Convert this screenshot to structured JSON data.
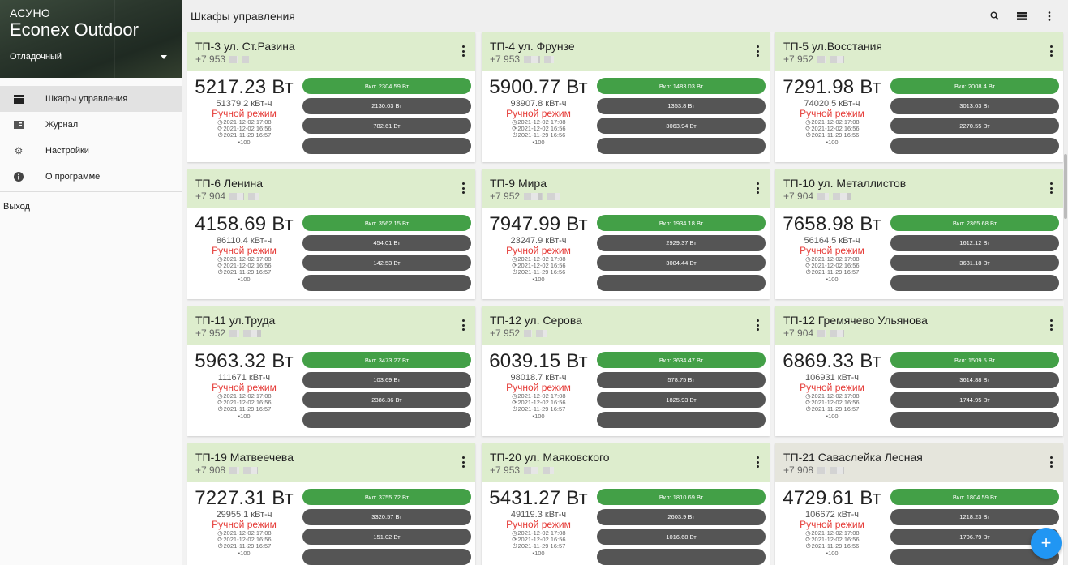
{
  "sidebar": {
    "app_small": "АСУНО",
    "app_big": "Econex Outdoor",
    "mode": "Отладочный",
    "items": [
      {
        "label": "Шкафы управления",
        "icon": "cabinet-list-icon",
        "active": true
      },
      {
        "label": "Журнал",
        "icon": "journal-icon",
        "active": false
      },
      {
        "label": "Настройки",
        "icon": "gear-icon",
        "active": false
      },
      {
        "label": "О программе",
        "icon": "info-icon",
        "active": false
      }
    ],
    "exit": "Выход"
  },
  "topbar": {
    "title": "Шкафы управления",
    "icons": [
      "search-icon",
      "list-view-icon",
      "more-vert-icon"
    ]
  },
  "cards": [
    {
      "title": "ТП-3 ул. Ст.Разина",
      "phone": "+7 953",
      "power": "5217.23 Вт",
      "energy": "51379.2 кВт-ч",
      "mode": "Ручной режим",
      "ts1": "2021-12-02 17:08",
      "ts2": "2021-12-02 16:56",
      "ts3": "2021-11-29 16:57",
      "msg": "100",
      "ch": [
        "Вкл: 2304.59 Вт",
        "2130.03 Вт",
        "782.61 Вт",
        ""
      ]
    },
    {
      "title": "ТП-4 ул. Фрунзе",
      "phone": "+7 953",
      "power": "5900.77 Вт",
      "energy": "93907.8 кВт-ч",
      "mode": "Ручной режим",
      "ts1": "2021-12-02 17:08",
      "ts2": "2021-12-02 16:56",
      "ts3": "2021-11-29 16:56",
      "msg": "100",
      "ch": [
        "Вкл: 1483.03 Вт",
        "1353.8 Вт",
        "3063.94 Вт",
        ""
      ]
    },
    {
      "title": "ТП-5 ул.Восстания",
      "phone": "+7 952",
      "power": "7291.98 Вт",
      "energy": "74020.5 кВт-ч",
      "mode": "Ручной режим",
      "ts1": "2021-12-02 17:08",
      "ts2": "2021-12-02 16:56",
      "ts3": "2021-11-29 16:56",
      "msg": "100",
      "ch": [
        "Вкл: 2008.4 Вт",
        "3013.03 Вт",
        "2270.55 Вт",
        ""
      ]
    },
    {
      "title": "ТП-6 Ленина",
      "phone": "+7 904",
      "power": "4158.69 Вт",
      "energy": "86110.4 кВт-ч",
      "mode": "Ручной режим",
      "ts1": "2021-12-02 17:08",
      "ts2": "2021-12-02 16:56",
      "ts3": "2021-11-29 16:57",
      "msg": "100",
      "ch": [
        "Вкл: 3562.15 Вт",
        "454.01 Вт",
        "142.53 Вт",
        ""
      ]
    },
    {
      "title": "ТП-9 Мира",
      "phone": "+7 952",
      "power": "7947.99 Вт",
      "energy": "23247.9 кВт-ч",
      "mode": "Ручной режим",
      "ts1": "2021-12-02 17:08",
      "ts2": "2021-12-02 16:56",
      "ts3": "2021-11-29 16:56",
      "msg": "100",
      "ch": [
        "Вкл: 1934.18 Вт",
        "2929.37 Вт",
        "3084.44 Вт",
        ""
      ]
    },
    {
      "title": "ТП-10 ул. Металлистов",
      "phone": "+7 904",
      "power": "7658.98 Вт",
      "energy": "56164.5 кВт-ч",
      "mode": "Ручной режим",
      "ts1": "2021-12-02 17:08",
      "ts2": "2021-12-02 16:56",
      "ts3": "2021-11-29 16:57",
      "msg": "100",
      "ch": [
        "Вкл: 2365.68 Вт",
        "1612.12 Вт",
        "3681.18 Вт",
        ""
      ]
    },
    {
      "title": "ТП-11 ул.Труда",
      "phone": "+7 952",
      "power": "5963.32 Вт",
      "energy": "111671 кВт-ч",
      "mode": "Ручной режим",
      "ts1": "2021-12-02 17:08",
      "ts2": "2021-12-02 16:56",
      "ts3": "2021-11-29 16:57",
      "msg": "100",
      "ch": [
        "Вкл: 3473.27 Вт",
        "103.69 Вт",
        "2386.36 Вт",
        ""
      ]
    },
    {
      "title": "ТП-12 ул. Серова",
      "phone": "+7 952",
      "power": "6039.15 Вт",
      "energy": "98018.7 кВт-ч",
      "mode": "Ручной режим",
      "ts1": "2021-12-02 17:08",
      "ts2": "2021-12-02 16:56",
      "ts3": "2021-11-29 16:57",
      "msg": "100",
      "ch": [
        "Вкл: 3634.47 Вт",
        "578.75 Вт",
        "1825.93 Вт",
        ""
      ]
    },
    {
      "title": "ТП-12 Гремячево Ульянова",
      "phone": "+7 904",
      "power": "6869.33 Вт",
      "energy": "106931 кВт-ч",
      "mode": "Ручной режим",
      "ts1": "2021-12-02 17:08",
      "ts2": "2021-12-02 16:56",
      "ts3": "2021-11-29 16:57",
      "msg": "100",
      "ch": [
        "Вкл: 1509.5 Вт",
        "3614.88 Вт",
        "1744.95 Вт",
        ""
      ]
    },
    {
      "title": "ТП-19 Матвеечева",
      "phone": "+7 908",
      "power": "7227.31 Вт",
      "energy": "29955.1 кВт-ч",
      "mode": "Ручной режим",
      "ts1": "2021-12-02 17:08",
      "ts2": "2021-12-02 16:56",
      "ts3": "2021-11-29 16:57",
      "msg": "100",
      "ch": [
        "Вкл: 3755.72 Вт",
        "3320.57 Вт",
        "151.02 Вт",
        ""
      ]
    },
    {
      "title": "ТП-20 ул. Маяковского",
      "phone": "+7 953",
      "power": "5431.27 Вт",
      "energy": "49119.3 кВт-ч",
      "mode": "Ручной режим",
      "ts1": "2021-12-02 17:08",
      "ts2": "2021-12-02 16:56",
      "ts3": "2021-11-29 16:57",
      "msg": "100",
      "ch": [
        "Вкл: 1810.69 Вт",
        "2603.9 Вт",
        "1016.68 Вт",
        ""
      ]
    },
    {
      "title": "ТП-21 Саваслейка Лесная",
      "phone": "+7 908",
      "power": "4729.61 Вт",
      "energy": "106672 кВт-ч",
      "mode": "Ручной режим",
      "ts1": "2021-12-02 17:08",
      "ts2": "2021-12-02 16:56",
      "ts3": "2021-11-29 16:56",
      "msg": "100",
      "ch": [
        "Вкл: 1804.59 Вт",
        "1218.23 Вт",
        "1706.79 Вт",
        ""
      ]
    }
  ],
  "fab_label": "+"
}
